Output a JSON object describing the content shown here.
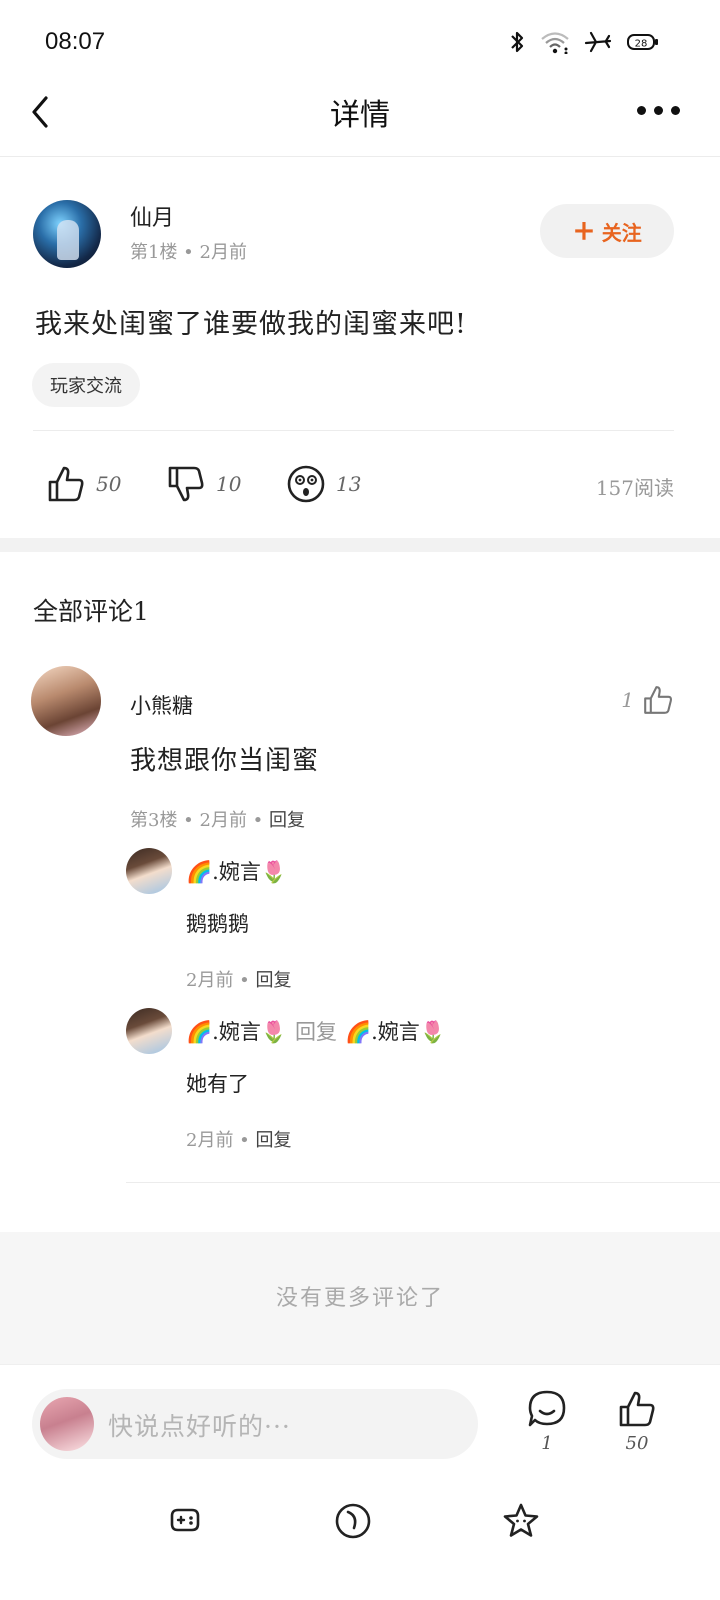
{
  "status_bar": {
    "time": "08:07",
    "icons": [
      "bluetooth-icon",
      "wifi-icon",
      "airplane-mode-icon",
      "battery-icon"
    ],
    "battery_level": "28"
  },
  "nav": {
    "title": "详情",
    "back_icon": "chevron-left-icon",
    "more_icon": "more-horizontal-icon"
  },
  "post": {
    "author": "仙月",
    "meta": "第1楼 • 2月前",
    "follow_label": "关注",
    "content": "我来处闺蜜了谁要做我的闺蜜来吧!",
    "tag": "玩家交流",
    "likes": "50",
    "dislikes": "10",
    "reactions": "13",
    "reads": "157阅读"
  },
  "comments": {
    "title": "全部评论1",
    "items": [
      {
        "name": "小熊糖",
        "likes": "1",
        "text": "我想跟你当闺蜜",
        "meta": "第3楼 • 2月前 • ",
        "reply_label": "回复",
        "replies": [
          {
            "name": "🌈.婉言🌷",
            "text": "鹅鹅鹅",
            "meta": "2月前 • ",
            "reply_label": "回复"
          },
          {
            "name": "🌈.婉言🌷",
            "reply_word": "回复",
            "reply_to": "🌈.婉言🌷",
            "text": "她有了",
            "meta": "2月前 • ",
            "reply_label": "回复"
          }
        ]
      }
    ],
    "end_text": "没有更多评论了"
  },
  "input_bar": {
    "placeholder": "快说点好听的···",
    "comment_count": "1",
    "like_count": "50"
  },
  "colors": {
    "accent": "#e8641f",
    "muted_text": "#999999",
    "pill_bg": "#f3f3f3"
  }
}
